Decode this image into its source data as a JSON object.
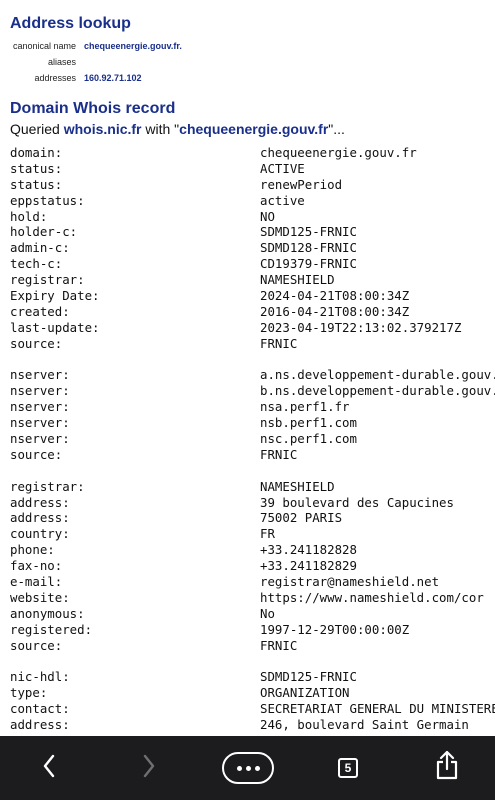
{
  "address_lookup": {
    "title": "Address lookup",
    "rows": [
      {
        "label": "canonical name",
        "value": "chequeenergie.gouv.fr."
      },
      {
        "label": "aliases",
        "value": ""
      },
      {
        "label": "addresses",
        "value": "160.92.71.102"
      }
    ]
  },
  "whois": {
    "title": "Domain Whois record",
    "queried_prefix": "Queried ",
    "server": "whois.nic.fr",
    "queried_middle": " with \"",
    "query": "chequeenergie.gouv.fr",
    "queried_suffix": "\"...",
    "lines": [
      {
        "key": "domain:",
        "value": "chequeenergie.gouv.fr"
      },
      {
        "key": "status:",
        "value": "ACTIVE"
      },
      {
        "key": "status:",
        "value": "renewPeriod"
      },
      {
        "key": "eppstatus:",
        "value": "active"
      },
      {
        "key": "hold:",
        "value": "NO"
      },
      {
        "key": "holder-c:",
        "value": "SDMD125-FRNIC"
      },
      {
        "key": "admin-c:",
        "value": "SDMD128-FRNIC"
      },
      {
        "key": "tech-c:",
        "value": "CD19379-FRNIC"
      },
      {
        "key": "registrar:",
        "value": "NAMESHIELD"
      },
      {
        "key": "Expiry Date:",
        "value": "2024-04-21T08:00:34Z"
      },
      {
        "key": "created:",
        "value": "2016-04-21T08:00:34Z"
      },
      {
        "key": "last-update:",
        "value": "2023-04-19T22:13:02.379217Z"
      },
      {
        "key": "source:",
        "value": "FRNIC"
      },
      {
        "key": "",
        "value": ""
      },
      {
        "key": "nserver:",
        "value": "a.ns.developpement-durable.gouv.fr"
      },
      {
        "key": "nserver:",
        "value": "b.ns.developpement-durable.gouv.fr"
      },
      {
        "key": "nserver:",
        "value": "nsa.perf1.fr"
      },
      {
        "key": "nserver:",
        "value": "nsb.perf1.com"
      },
      {
        "key": "nserver:",
        "value": "nsc.perf1.com"
      },
      {
        "key": "source:",
        "value": "FRNIC"
      },
      {
        "key": "",
        "value": ""
      },
      {
        "key": "registrar:",
        "value": "NAMESHIELD"
      },
      {
        "key": "address:",
        "value": "39 boulevard des Capucines"
      },
      {
        "key": "address:",
        "value": "75002 PARIS"
      },
      {
        "key": "country:",
        "value": "FR"
      },
      {
        "key": "phone:",
        "value": "+33.241182828"
      },
      {
        "key": "fax-no:",
        "value": "+33.241182829"
      },
      {
        "key": "e-mail:",
        "value": "registrar@nameshield.net"
      },
      {
        "key": "website:",
        "value": "https://www.nameshield.com/cor"
      },
      {
        "key": "anonymous:",
        "value": "No"
      },
      {
        "key": "registered:",
        "value": "1997-12-29T00:00:00Z"
      },
      {
        "key": "source:",
        "value": "FRNIC"
      },
      {
        "key": "",
        "value": ""
      },
      {
        "key": "nic-hdl:",
        "value": "SDMD125-FRNIC"
      },
      {
        "key": "type:",
        "value": "ORGANIZATION"
      },
      {
        "key": "contact:",
        "value": "SECRETARIAT GENERAL DU MINISTERE"
      },
      {
        "key": "address:",
        "value": "246, boulevard Saint Germain"
      }
    ]
  },
  "toolbar": {
    "back_icon": "chevron-left-icon",
    "forward_icon": "chevron-right-icon",
    "more_icon": "ellipsis-icon",
    "tabs_count": "5",
    "share_icon": "share-icon"
  }
}
